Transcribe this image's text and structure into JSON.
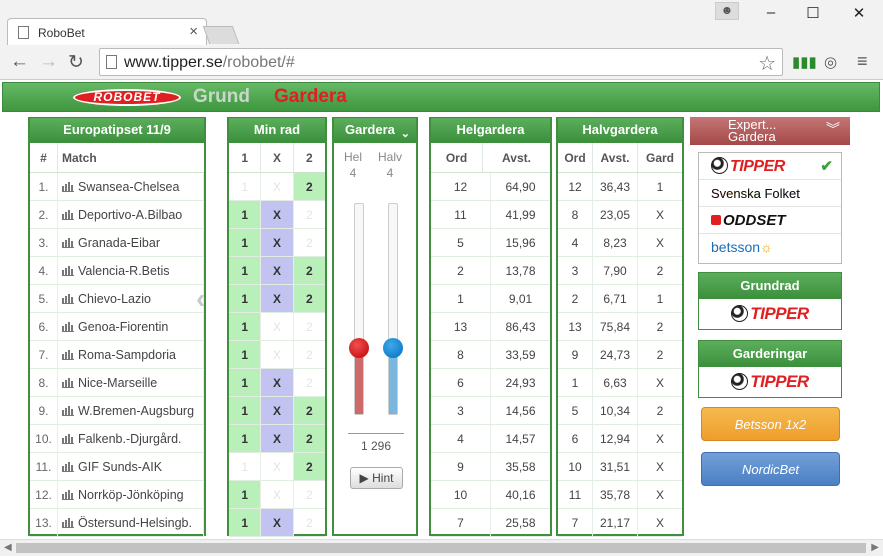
{
  "browser": {
    "tab_title": "RoboBet",
    "url_host": "www.tipper.se",
    "url_path": "/robobet/#"
  },
  "header": {
    "logo": "ROBOBET",
    "mode_grund": "Grund",
    "mode_gardera": "Gardera"
  },
  "coupon": {
    "title": "Europatipset 11/9",
    "col_num": "#",
    "col_match": "Match",
    "matches": [
      {
        "num": "1.",
        "name": "Swansea-Chelsea"
      },
      {
        "num": "2.",
        "name": "Deportivo-A.Bilbao"
      },
      {
        "num": "3.",
        "name": "Granada-Eibar"
      },
      {
        "num": "4.",
        "name": "Valencia-R.Betis"
      },
      {
        "num": "5.",
        "name": "Chievo-Lazio"
      },
      {
        "num": "6.",
        "name": "Genoa-Fiorentin"
      },
      {
        "num": "7.",
        "name": "Roma-Sampdoria"
      },
      {
        "num": "8.",
        "name": "Nice-Marseille"
      },
      {
        "num": "9.",
        "name": "W.Bremen-Augsburg"
      },
      {
        "num": "10.",
        "name": "Falkenb.-Djurgård."
      },
      {
        "num": "11.",
        "name": "GIF Sunds-AIK"
      },
      {
        "num": "12.",
        "name": "Norrköp-Jönköping"
      },
      {
        "num": "13.",
        "name": "Östersund-Helsingb."
      }
    ]
  },
  "minrad": {
    "title": "Min rad",
    "cols": [
      "1",
      "X",
      "2"
    ],
    "rows": [
      [
        false,
        false,
        true
      ],
      [
        true,
        true,
        false
      ],
      [
        true,
        true,
        false
      ],
      [
        true,
        true,
        true
      ],
      [
        true,
        true,
        true
      ],
      [
        true,
        false,
        false
      ],
      [
        true,
        false,
        false
      ],
      [
        true,
        true,
        false
      ],
      [
        true,
        true,
        true
      ],
      [
        true,
        true,
        true
      ],
      [
        false,
        false,
        true
      ],
      [
        true,
        false,
        false
      ],
      [
        true,
        true,
        false
      ]
    ]
  },
  "gardera": {
    "title": "Gardera",
    "hel_label": "Hel",
    "halv_label": "Halv",
    "hel_value": "4",
    "halv_value": "4",
    "hel_level": 0.31,
    "halv_level": 0.31,
    "total": "1 296",
    "hint_label": "Hint"
  },
  "helgardera": {
    "title": "Helgardera",
    "col_ord": "Ord",
    "col_avst": "Avst.",
    "rows": [
      [
        "12",
        "64,90"
      ],
      [
        "11",
        "41,99"
      ],
      [
        "5",
        "15,96"
      ],
      [
        "2",
        "13,78"
      ],
      [
        "1",
        "9,01"
      ],
      [
        "13",
        "86,43"
      ],
      [
        "8",
        "33,59"
      ],
      [
        "6",
        "24,93"
      ],
      [
        "3",
        "14,56"
      ],
      [
        "4",
        "14,57"
      ],
      [
        "9",
        "35,58"
      ],
      [
        "10",
        "40,16"
      ],
      [
        "7",
        "25,58"
      ]
    ]
  },
  "halvgardera": {
    "title": "Halvgardera",
    "col_ord": "Ord",
    "col_avst": "Avst.",
    "col_gard": "Gard",
    "rows": [
      [
        "12",
        "36,43",
        "1"
      ],
      [
        "8",
        "23,05",
        "X"
      ],
      [
        "4",
        "8,23",
        "X"
      ],
      [
        "3",
        "7,90",
        "2"
      ],
      [
        "2",
        "6,71",
        "1"
      ],
      [
        "13",
        "75,84",
        "2"
      ],
      [
        "9",
        "24,73",
        "2"
      ],
      [
        "1",
        "6,63",
        "X"
      ],
      [
        "5",
        "10,34",
        "2"
      ],
      [
        "6",
        "12,94",
        "X"
      ],
      [
        "10",
        "31,51",
        "X"
      ],
      [
        "11",
        "35,78",
        "X"
      ],
      [
        "7",
        "21,17",
        "X"
      ]
    ]
  },
  "sidebar": {
    "expert_line1": "Expert...",
    "expert_line2": "Gardera",
    "sources": {
      "tipper": "TIPPER",
      "svenska": "Svenska Folket",
      "oddset": "ODDSET",
      "betsson": "betsson"
    },
    "grundrad_title": "Grundrad",
    "grundrad_brand": "TIPPER",
    "garderingar_title": "Garderingar",
    "garderingar_brand": "TIPPER",
    "betsson_btn": "Betsson 1x2",
    "nordic_btn": "NordicBet"
  },
  "colors": {
    "green_header": "#3e963e",
    "selected_1_2": "#b9efb9",
    "selected_x": "#c3c3f2",
    "tipper_red": "#e02020",
    "betsson_orange": "#ee9e2c",
    "nordic_blue": "#4b7fc4"
  }
}
